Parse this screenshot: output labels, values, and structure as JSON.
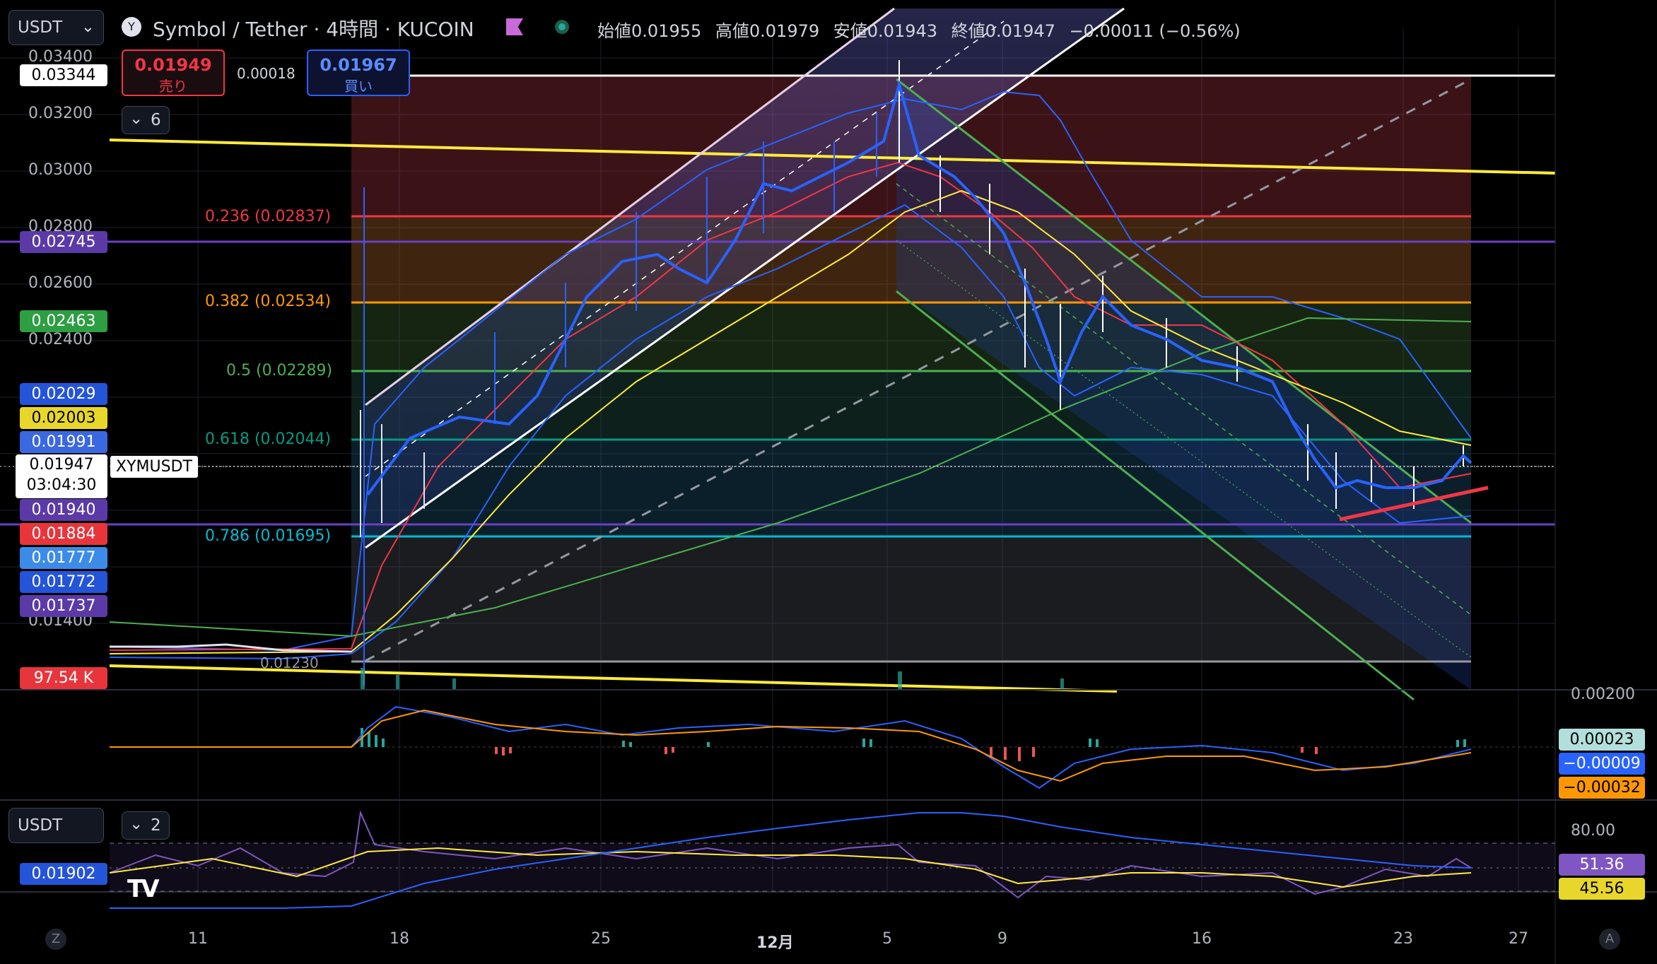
{
  "header": {
    "currency_select": "USDT",
    "symbol_title": "Symbol / Tether · 4時間 · KUCOIN",
    "ohlc": {
      "open_label": "始値",
      "open": "0.01955",
      "high_label": "高値",
      "high": "0.01979",
      "low_label": "安値",
      "low": "0.01943",
      "close_label": "終値",
      "close": "0.01947",
      "change": "−0.00011 (−0.56%)"
    },
    "sell_price": "0.01949",
    "sell_label": "売り",
    "spread": "0.00018",
    "buy_price": "0.01967",
    "buy_label": "買い",
    "indicator_count": "6"
  },
  "price_axis": {
    "ticks": [
      "0.03400",
      "0.03200",
      "0.03000",
      "0.02800",
      "0.02600",
      "0.02400",
      "0.01400"
    ],
    "tags": [
      {
        "value": "0.03344",
        "bg": "#ffffff",
        "fg": "#000000"
      },
      {
        "value": "0.02745",
        "bg": "#5b3aa8",
        "fg": "#ffffff"
      },
      {
        "value": "0.02463",
        "bg": "#2e9e43",
        "fg": "#ffffff"
      },
      {
        "value": "0.02029",
        "bg": "#2454d8",
        "fg": "#ffffff"
      },
      {
        "value": "0.02003",
        "bg": "#e8d72a",
        "fg": "#000000"
      },
      {
        "value": "0.01991",
        "bg": "#3a68e0",
        "fg": "#ffffff"
      },
      {
        "value": "0.01940",
        "bg": "#5b3aa8",
        "fg": "#ffffff"
      },
      {
        "value": "0.01884",
        "bg": "#e8353c",
        "fg": "#ffffff"
      },
      {
        "value": "0.01777",
        "bg": "#3d8be8",
        "fg": "#ffffff"
      },
      {
        "value": "0.01772",
        "bg": "#2454d8",
        "fg": "#ffffff"
      },
      {
        "value": "0.01737",
        "bg": "#5b3aa8",
        "fg": "#ffffff"
      }
    ],
    "current_price": "0.01947",
    "countdown": "03:04:30",
    "symbol_tag": "XYMUSDT",
    "volume_tag": "97.54 K",
    "low_marker": "0.01230"
  },
  "fib_levels": [
    {
      "label": "0.236 (0.02837)",
      "color": "#f23645"
    },
    {
      "label": "0.382 (0.02534)",
      "color": "#ff9800"
    },
    {
      "label": "0.5 (0.02289)",
      "color": "#4caf50"
    },
    {
      "label": "0.618 (0.02044)",
      "color": "#089981"
    },
    {
      "label": "0.786 (0.01695)",
      "color": "#00bcd4"
    }
  ],
  "macd_pane": {
    "axis_top": "0.00200",
    "values": [
      {
        "value": "0.00023",
        "bg": "#b2dfdb",
        "fg": "#000000"
      },
      {
        "value": "−0.00009",
        "bg": "#2962ff",
        "fg": "#ffffff"
      },
      {
        "value": "−0.00032",
        "bg": "#ff9800",
        "fg": "#000000"
      }
    ]
  },
  "rsi_pane": {
    "currency_select": "USDT",
    "indicator_count": "2",
    "left_tag": "0.01902",
    "level_80": "80.00",
    "values": [
      {
        "value": "51.36",
        "bg": "#7e57c2",
        "fg": "#ffffff"
      },
      {
        "value": "45.56",
        "bg": "#e8d72a",
        "fg": "#000000"
      }
    ]
  },
  "time_axis": {
    "labels": [
      "11",
      "18",
      "25",
      "12月",
      "5",
      "9",
      "16",
      "23",
      "27"
    ],
    "left_button": "Z",
    "right_button": "A"
  },
  "logo": "TV"
}
